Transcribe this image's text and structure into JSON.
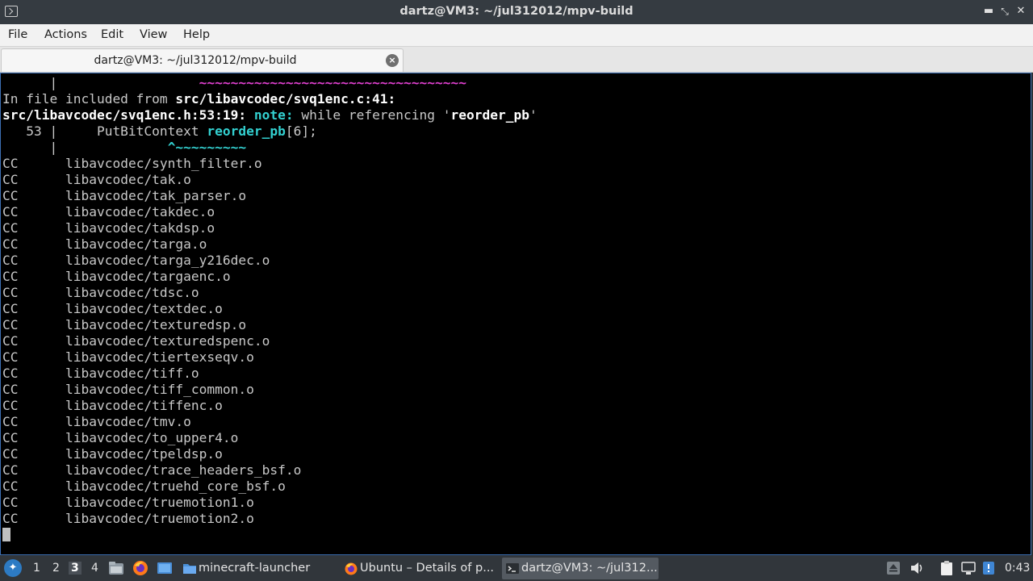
{
  "window": {
    "title": "dartz@VM3: ~/jul312012/mpv-build",
    "icon": "terminal-window-icon",
    "buttons": [
      "minimize-icon",
      "maximize-icon",
      "close-icon"
    ]
  },
  "menu": [
    "File",
    "Actions",
    "Edit",
    "View",
    "Help"
  ],
  "tab": {
    "title": "dartz@VM3: ~/jul312012/mpv-build",
    "close_icon": "close-circle-icon"
  },
  "terminal": {
    "header": {
      "l0": {
        "gutter": "      |",
        "pad": "                  ",
        "tilde": "~~~~~~~~~~~~~~~~~~~~~~~~~~~~~~~~~~"
      },
      "l1": {
        "prefix": "In file included from ",
        "file": "src/libavcodec/svq1enc.c:41",
        "suffix": ":"
      },
      "l2": {
        "loc": "src/libavcodec/svq1enc.h:53:19:",
        "note": "note:",
        "msg": " while referencing '",
        "ident": "reorder_pb",
        "end": "'"
      },
      "l3": {
        "lineno": "   53 |     PutBitContext ",
        "ident": "reorder_pb",
        "rest": "[6];"
      },
      "l4": {
        "gutter": "      |",
        "pad": "              ",
        "caret": "^~~~~~~~~~"
      }
    },
    "cc_label": "CC",
    "cc_lines": [
      "libavcodec/synth_filter.o",
      "libavcodec/tak.o",
      "libavcodec/tak_parser.o",
      "libavcodec/takdec.o",
      "libavcodec/takdsp.o",
      "libavcodec/targa.o",
      "libavcodec/targa_y216dec.o",
      "libavcodec/targaenc.o",
      "libavcodec/tdsc.o",
      "libavcodec/textdec.o",
      "libavcodec/texturedsp.o",
      "libavcodec/texturedspenc.o",
      "libavcodec/tiertexseqv.o",
      "libavcodec/tiff.o",
      "libavcodec/tiff_common.o",
      "libavcodec/tiffenc.o",
      "libavcodec/tmv.o",
      "libavcodec/to_upper4.o",
      "libavcodec/tpeldsp.o",
      "libavcodec/trace_headers_bsf.o",
      "libavcodec/truehd_core_bsf.o",
      "libavcodec/truemotion1.o",
      "libavcodec/truemotion2.o"
    ]
  },
  "taskbar": {
    "start_icon": "lubuntu-logo-icon",
    "desktops": [
      "1",
      "2",
      "3",
      "4"
    ],
    "active_desktop": "3",
    "quicklaunch": [
      "file-manager-icon",
      "firefox-icon",
      "show-desktop-icon"
    ],
    "tasks": [
      {
        "icon": "folder-icon",
        "label": "minecraft-launcher"
      },
      {
        "icon": "firefox-icon",
        "label": "Ubuntu – Details of p..."
      },
      {
        "icon": "terminal-icon",
        "label": "dartz@VM3: ~/jul312..."
      }
    ],
    "tray": [
      "eject-icon",
      "volume-icon",
      "clipboard-icon",
      "network-icon",
      "update-notifier-icon"
    ],
    "clock": "0:43"
  }
}
